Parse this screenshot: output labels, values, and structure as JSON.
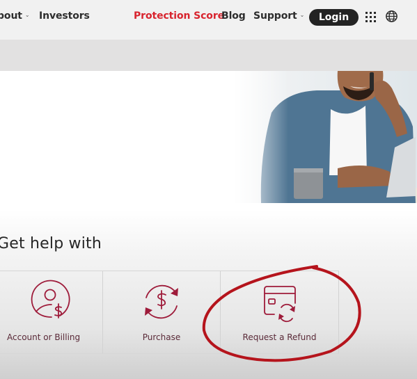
{
  "nav": {
    "items": [
      {
        "label": "bout",
        "has_dropdown": true
      },
      {
        "label": "Investors",
        "has_dropdown": false
      },
      {
        "label": "Protection Score",
        "has_dropdown": false,
        "highlight": true
      },
      {
        "label": "Blog",
        "has_dropdown": false
      },
      {
        "label": "Support",
        "has_dropdown": true
      }
    ],
    "login_label": "Login",
    "apps_icon": "grid-icon",
    "language_icon": "globe-icon"
  },
  "hero": {
    "image": "man-on-phone-with-laptop-photo"
  },
  "help": {
    "title": "Get help with",
    "cards": [
      {
        "label": "Account or Billing",
        "icon": "user-dollar-icon"
      },
      {
        "label": "Purchase",
        "icon": "dollar-cycle-icon"
      },
      {
        "label": "Request a Refund",
        "icon": "card-refund-icon",
        "annotated": true
      }
    ]
  },
  "colors": {
    "accent_red": "#d8242e",
    "icon_maroon": "#9e1b3a",
    "annotation_red": "#b5141c",
    "login_bg": "#232323"
  }
}
